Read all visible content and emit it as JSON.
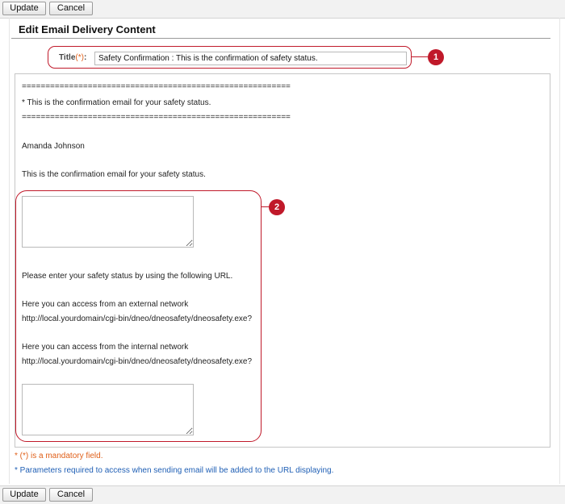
{
  "toolbar": {
    "update_label": "Update",
    "cancel_label": "Cancel"
  },
  "page": {
    "heading": "Edit Email Delivery Content"
  },
  "title_field": {
    "label": "Title",
    "required_mark": "(*)",
    "colon": ":",
    "value": "Safety Confirmation : This is the confirmation of safety status."
  },
  "body": {
    "separator_top": "=========================================================",
    "headline": "* This is the confirmation email for your safety status.",
    "separator_bottom": "=========================================================",
    "recipient": "Amanda Johnson",
    "intro": "This is the confirmation email for your safety status.",
    "instruction": "Please enter your safety status by using the following URL.",
    "external_label": "Here you can access from an external network",
    "external_url": "http://local.yourdomain/cgi-bin/dneo/dneosafety/dneosafety.exe?",
    "internal_label": "Here you can access from the internal network",
    "internal_url": "http://local.yourdomain/cgi-bin/dneo/dneosafety/dneosafety.exe?",
    "param_area_top_value": "",
    "param_area_bottom_value": ""
  },
  "callouts": {
    "one": "1",
    "two": "2"
  },
  "notes": {
    "mandatory": "* (*) is a mandatory field.",
    "parameters": "* Parameters required to access when sending email will be added to the URL displaying."
  },
  "colors": {
    "required": "#e0601a",
    "info": "#1f5fb5",
    "callout": "#c0192a"
  }
}
